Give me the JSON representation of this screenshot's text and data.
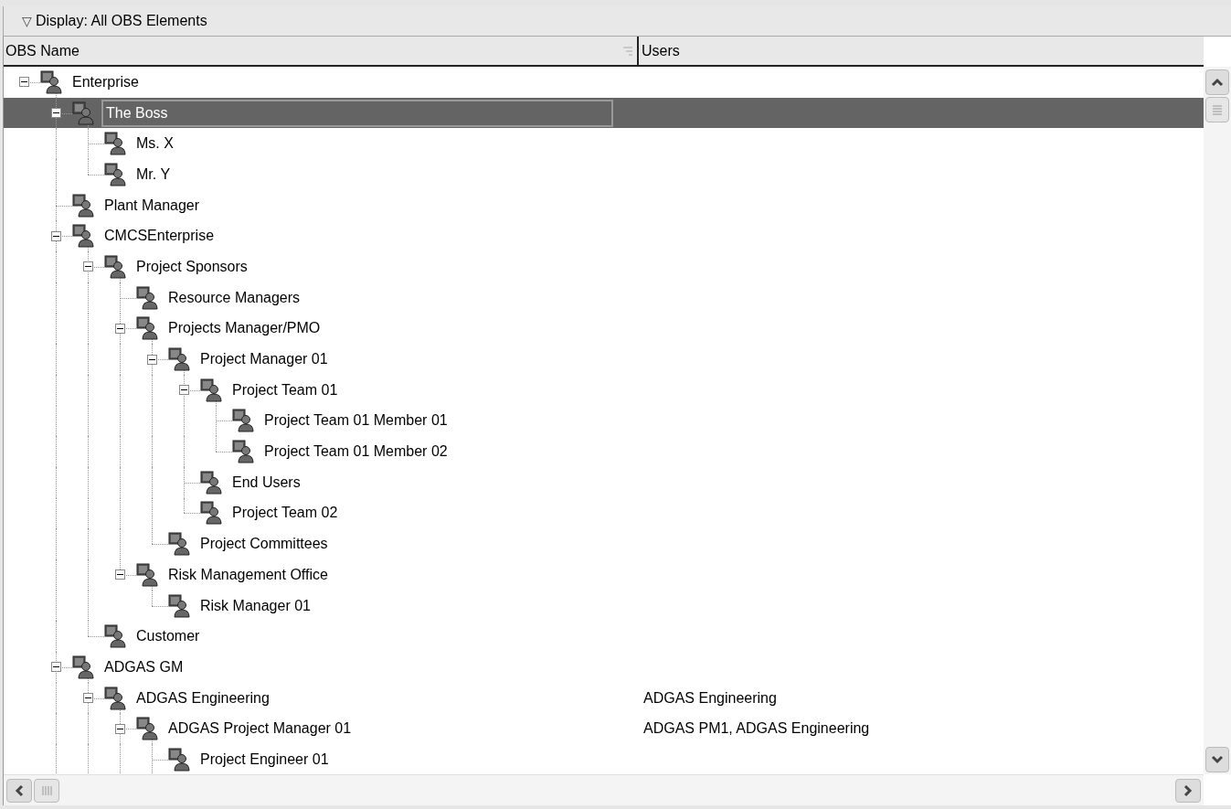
{
  "display_bar": {
    "arrow": "▽",
    "label": "Display: All OBS Elements"
  },
  "columns": [
    "OBS Name",
    "Users"
  ],
  "tree": [
    {
      "name": "Enterprise",
      "selected": false,
      "expanded": true,
      "children": [
        {
          "name": "The Boss",
          "selected": true,
          "expanded": true,
          "children": [
            {
              "name": "Ms. X",
              "selected": false
            },
            {
              "name": "Mr. Y",
              "selected": false
            }
          ]
        },
        {
          "name": "Plant Manager",
          "selected": false
        },
        {
          "name": "CMCSEnterprise",
          "selected": false,
          "expanded": true,
          "children": [
            {
              "name": "Project Sponsors",
              "selected": false,
              "expanded": true,
              "children": [
                {
                  "name": "Resource Managers",
                  "selected": false
                },
                {
                  "name": "Projects Manager/PMO",
                  "selected": false,
                  "expanded": true,
                  "children": [
                    {
                      "name": "Project Manager 01",
                      "selected": false,
                      "expanded": true,
                      "children": [
                        {
                          "name": "Project Team 01",
                          "selected": false,
                          "expanded": true,
                          "children": [
                            {
                              "name": "Project Team 01 Member 01",
                              "selected": false
                            },
                            {
                              "name": "Project Team 01 Member 02",
                              "selected": false
                            }
                          ]
                        },
                        {
                          "name": "End Users",
                          "selected": false
                        },
                        {
                          "name": "Project Team 02",
                          "selected": false
                        }
                      ]
                    },
                    {
                      "name": "Project Committees",
                      "selected": false
                    }
                  ]
                },
                {
                  "name": "Risk Management Office",
                  "selected": false,
                  "expanded": true,
                  "children": [
                    {
                      "name": "Risk Manager 01",
                      "selected": false
                    }
                  ]
                }
              ]
            },
            {
              "name": "Customer",
              "selected": false
            }
          ]
        },
        {
          "name": "ADGAS GM",
          "selected": false,
          "expanded": true,
          "children": [
            {
              "name": "ADGAS Engineering",
              "users": "ADGAS Engineering",
              "selected": false,
              "expanded": true,
              "children": [
                {
                  "name": "ADGAS Project Manager 01",
                  "users": "ADGAS PM1, ADGAS Engineering",
                  "selected": false,
                  "expanded": true,
                  "children": [
                    {
                      "name": "Project Engineer 01",
                      "selected": false
                    }
                  ]
                }
              ]
            }
          ]
        }
      ]
    }
  ]
}
